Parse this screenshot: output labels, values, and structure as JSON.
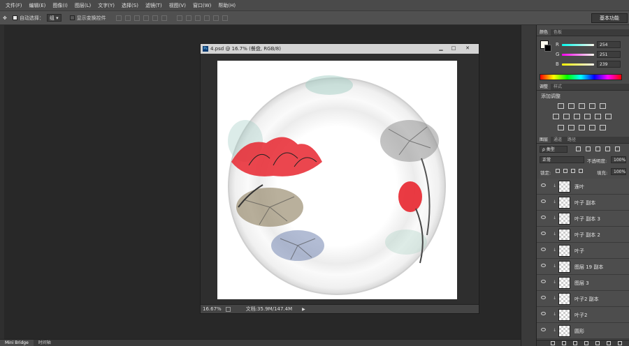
{
  "menu": [
    "文件(F)",
    "编辑(E)",
    "图像(I)",
    "图层(L)",
    "文字(Y)",
    "选择(S)",
    "滤镜(T)",
    "视图(V)",
    "窗口(W)",
    "帮助(H)"
  ],
  "options": {
    "auto_select": "自动选择：",
    "auto_select_value": "组",
    "show_transform": "显示变换控件"
  },
  "workspace": "基本功能",
  "doc": {
    "title": "4.psd @ 16.7% (餐盘, RGB/8)",
    "zoom": "16.67%",
    "doc_size": "文档:35.9M/147.4M"
  },
  "bottom_tabs": [
    "Mini Bridge",
    "时间轴"
  ],
  "color_panel": {
    "tabs": [
      "颜色",
      "色板"
    ],
    "channels": [
      {
        "label": "R",
        "value": "254",
        "color": "#ff4444"
      },
      {
        "label": "G",
        "value": "251",
        "color": "#44dd44"
      },
      {
        "label": "B",
        "value": "239",
        "color": "#5577ff"
      }
    ]
  },
  "adjust_panel": {
    "tabs": [
      "调整",
      "样式"
    ],
    "title": "添加调整"
  },
  "layers_panel": {
    "tabs": [
      "图层",
      "通道",
      "路径"
    ],
    "filter": "ρ 类型",
    "blend": "正常",
    "opacity_label": "不透明度:",
    "opacity": "100%",
    "lock_label": "锁定:",
    "fill_label": "填充:",
    "fill": "100%",
    "layers": [
      "莲叶",
      "叶子 副本",
      "叶子 副本 3",
      "叶子 副本 2",
      "叶子",
      "图层 19 副本",
      "图层 3",
      "叶子2 副本",
      "叶子2",
      "圆形"
    ]
  },
  "colors": {
    "accent_red": "#e8262f",
    "plate_white": "#ffffff",
    "ui_dark": "#282828"
  }
}
